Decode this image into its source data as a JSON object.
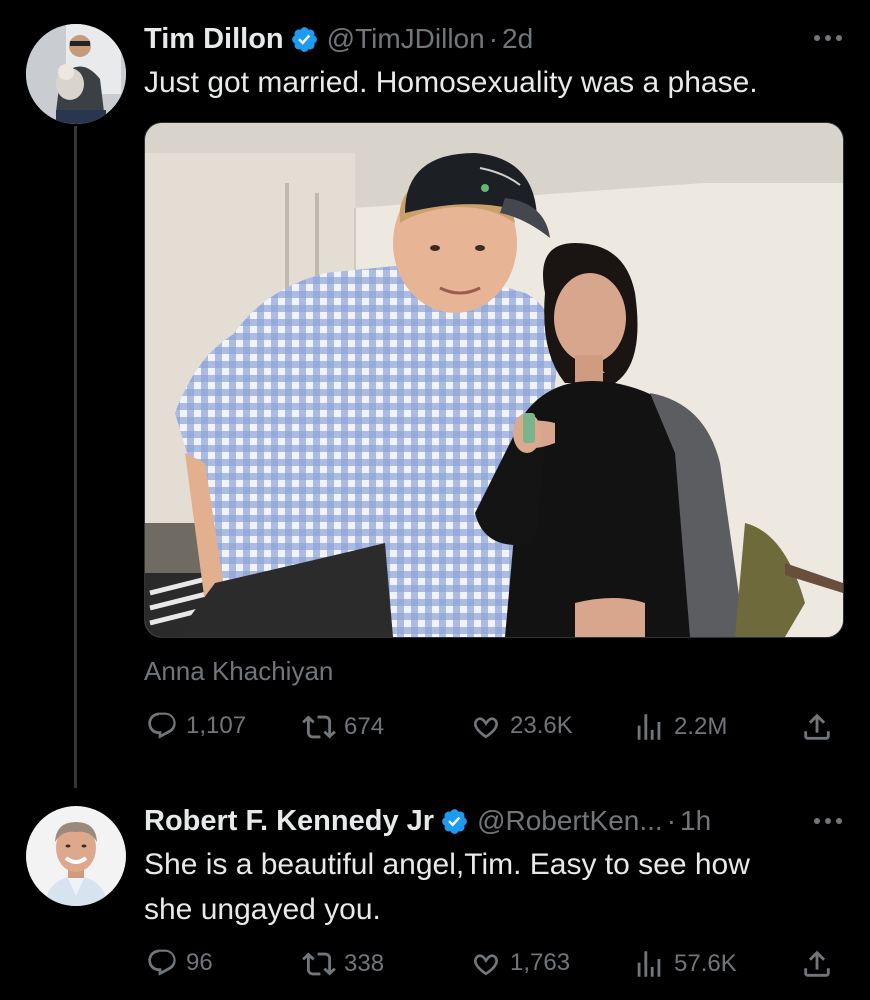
{
  "tweet1": {
    "display_name": "Tim Dillon",
    "handle": "@TimJDillon",
    "time": "2d",
    "text": "Just got married. Homosexuality was a phase.",
    "photo_tag": "Anna Khachiyan",
    "replies": "1,107",
    "retweets": "674",
    "likes": "23.6K",
    "views": "2.2M"
  },
  "tweet2": {
    "display_name": "Robert F. Kennedy Jr",
    "handle": "@RobertKen...",
    "time": "1h",
    "text_line1": "She is a beautiful angel,Tim. Easy to see how",
    "text_line2": "she ungayed you.",
    "replies": "96",
    "retweets": "338",
    "likes": "1,763",
    "views": "57.6K"
  },
  "colors": {
    "background": "#000000",
    "text": "#e7e9ea",
    "muted": "#71767b",
    "verified": "#1d9bf0"
  },
  "icons": [
    "verified-badge-icon",
    "more-icon",
    "reply-icon",
    "retweet-icon",
    "like-icon",
    "views-icon",
    "share-icon"
  ]
}
